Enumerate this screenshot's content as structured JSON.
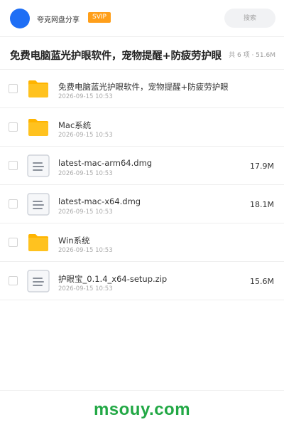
{
  "header": {
    "app_name": "夸克网盘分享",
    "badge": "SVIP",
    "search_placeholder": "搜索",
    "avatar_color": "#1e6ef5"
  },
  "page": {
    "title": "免费电脑蓝光护眼软件，宠物提醒+防疲劳护眼",
    "meta": "共 6 项 · 51.6M"
  },
  "files": [
    {
      "type": "folder",
      "icon": "folder-icon",
      "name": "免费电脑蓝光护眼软件，宠物提醒+防疲劳护眼",
      "date": "2026-09-15 10:53",
      "size": ""
    },
    {
      "type": "folder",
      "icon": "folder-icon",
      "name": "Mac系统",
      "date": "2026-09-15 10:53",
      "size": ""
    },
    {
      "type": "file",
      "icon": "file-icon",
      "name": "latest-mac-arm64.dmg",
      "date": "2026-09-15 10:53",
      "size": "17.9M"
    },
    {
      "type": "file",
      "icon": "file-icon",
      "name": "latest-mac-x64.dmg",
      "date": "2026-09-15 10:53",
      "size": "18.1M"
    },
    {
      "type": "folder",
      "icon": "folder-icon",
      "name": "Win系统",
      "date": "2026-09-15 10:53",
      "size": ""
    },
    {
      "type": "file",
      "icon": "file-icon",
      "name": "护眼宝_0.1.4_x64-setup.zip",
      "date": "2026-09-15 10:53",
      "size": "15.6M"
    }
  ],
  "watermark": "msouy.com",
  "colors": {
    "accent": "#1e6ef5",
    "svip": "#ff9f1a",
    "folder": "#ffc21f",
    "watermark": "#22a845"
  }
}
